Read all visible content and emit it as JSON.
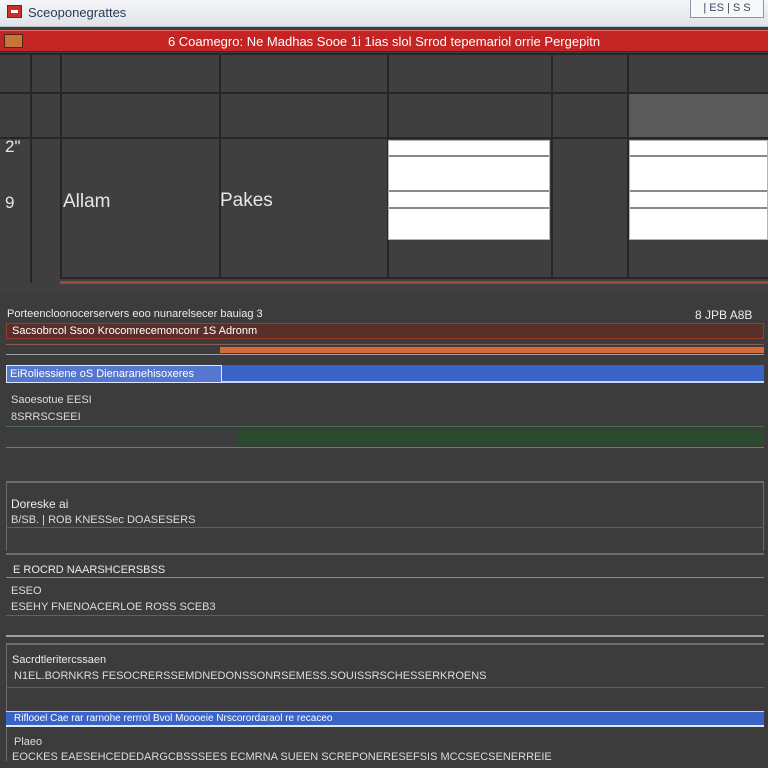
{
  "window": {
    "title": "Sceoponegrattes",
    "controls_label": "| ES | S S"
  },
  "app": {
    "banner_title": "6 Coamegro: Ne Madhas Sooe 1i 1ias slol Srrod tepemariol orrie Pergepitn"
  },
  "grid": {
    "row_numbers": [
      "2\"",
      "9"
    ],
    "cells": [
      {
        "label": "Allam"
      },
      {
        "label": "Pakes"
      }
    ]
  },
  "panel": {
    "header_left": "Porteencloonocerservers eoo nunarelsecer bauiag 3",
    "header_right": "8 JPB A8B",
    "orange_row": "Sacsobrcol Ssoo Krocomrecemonconr 1S Adronm",
    "blue_row": "EiRoliessiene oS Dienaranehisoxeres",
    "line1": "Saoesotue EESI",
    "line2": "8SRRSCSEEI",
    "section1": {
      "title": "Doreske  ai",
      "line": "B/SB. | ROB  KNESSec  DOASESERS"
    },
    "section2": {
      "title": "E  ROCRD NAARSHCERSBSS",
      "sub": "ESEO",
      "line": "ESEHY FNENOACERLOE ROSS SCEB3"
    },
    "section3": {
      "title": "Sacrdtleritercssaen",
      "line": "N1EL.BORNKRS FESOCRERSSEMDNEDONSSONRSEMESS.SOUISSRSCHESSERKROENS",
      "blue_row": "Riflooel  Cae rar rarnohe rerrrol Bvol  Moooeie Nrscorordaraol re recaceo",
      "footer_title": "Plaeo",
      "footer_line": "EOCKES  EAESEHCEDEDARGCBSSSEES ECMRNA SUEEN SCREPONERESEFSIS MCCSECSENERREIE"
    }
  },
  "colors": {
    "accent_red": "#c42423",
    "accent_blue": "#3a63c8",
    "accent_orange": "#d8693a",
    "background": "#3c3c3c"
  }
}
